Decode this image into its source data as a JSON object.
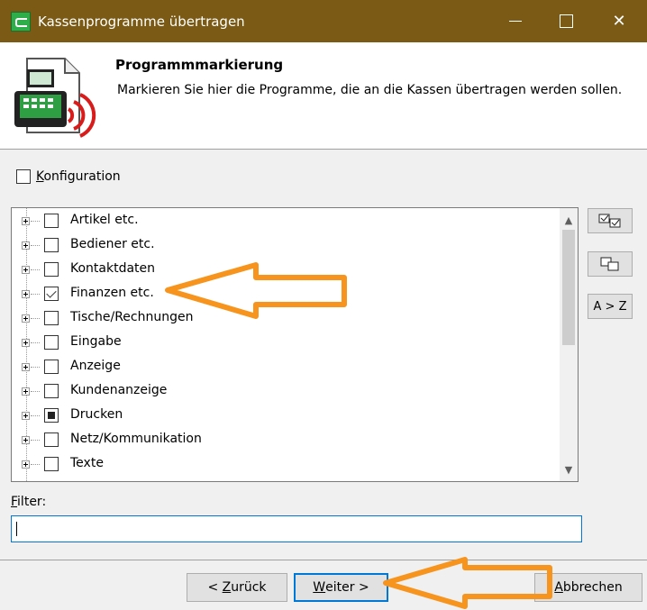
{
  "window": {
    "title": "Kassenprogramme übertragen",
    "close_glyph": "✕"
  },
  "header": {
    "title": "Programmmarkierung",
    "description": "Markieren Sie hier die Programme, die an die Kassen übertragen werden sollen."
  },
  "konfiguration": {
    "label_prefix": "K",
    "label_rest": "onfiguration",
    "checked": false
  },
  "tree": {
    "items": [
      {
        "label": "Artikel etc.",
        "state": "unchecked"
      },
      {
        "label": "Bediener etc.",
        "state": "unchecked"
      },
      {
        "label": "Kontaktdaten",
        "state": "unchecked"
      },
      {
        "label": "Finanzen etc.",
        "state": "checked"
      },
      {
        "label": "Tische/Rechnungen",
        "state": "unchecked"
      },
      {
        "label": "Eingabe",
        "state": "unchecked"
      },
      {
        "label": "Anzeige",
        "state": "unchecked"
      },
      {
        "label": "Kundenanzeige",
        "state": "unchecked"
      },
      {
        "label": "Drucken",
        "state": "indeterminate"
      },
      {
        "label": "Netz/Kommunikation",
        "state": "unchecked"
      },
      {
        "label": "Texte",
        "state": "unchecked"
      }
    ],
    "scroll_up": "▲",
    "scroll_down": "▼"
  },
  "side_buttons": {
    "check_all_icon": "check-all-icon",
    "uncheck_all_icon": "uncheck-all-icon",
    "sort_label": "A > Z"
  },
  "filter": {
    "label_prefix": "F",
    "label_rest": "ilter:",
    "value": ""
  },
  "buttons": {
    "back_prefix": "< ",
    "back_key": "Z",
    "back_rest": "urück",
    "next_key": "W",
    "next_rest": "eiter >",
    "cancel_key": "A",
    "cancel_rest": "bbrechen"
  },
  "colors": {
    "titlebar": "#7a5a14",
    "annotation_arrow": "#f7941d",
    "focus_border": "#0078d7"
  }
}
